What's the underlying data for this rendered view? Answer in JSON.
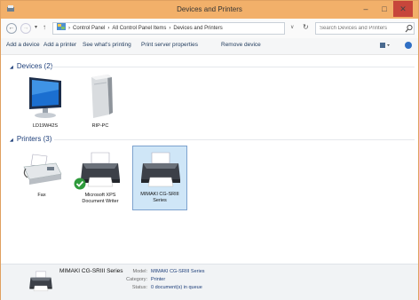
{
  "window": {
    "title": "Devices and Printers"
  },
  "titlebar": {
    "minimize_glyph": "–",
    "maximize_glyph": "□",
    "close_glyph": "✕"
  },
  "addressbar": {
    "breadcrumb": [
      "Control Panel",
      "All Control Panel Items",
      "Devices and Printers"
    ],
    "separator": "›",
    "search_placeholder": "Search Devices and Printers"
  },
  "commandbar": {
    "add_device": "Add a device",
    "add_printer": "Add a printer",
    "see_printing": "See what's printing",
    "print_server": "Print server properties",
    "remove_device": "Remove device"
  },
  "groups": {
    "devices": {
      "label": "Devices (2)",
      "items": [
        {
          "label": "LD19W42S"
        },
        {
          "label": "RIP-PC"
        }
      ]
    },
    "printers": {
      "label": "Printers (3)",
      "items": [
        {
          "label": "Fax"
        },
        {
          "label": "Microsoft XPS Document Writer"
        },
        {
          "label": "MIMAKI CG-SRIII Series"
        }
      ]
    }
  },
  "details": {
    "name": "MIMAKI CG-SRIII Series",
    "model_key": "Model:",
    "model_val": "MIMAKI CG-SRIII Series",
    "category_key": "Category:",
    "category_val": "Printer",
    "status_key": "Status:",
    "status_val": "0 document(s) in queue"
  },
  "colors": {
    "titlebar": "#f2b06a",
    "close": "#c7463b",
    "selection": "#cfe6f7",
    "link": "#1e395b"
  }
}
